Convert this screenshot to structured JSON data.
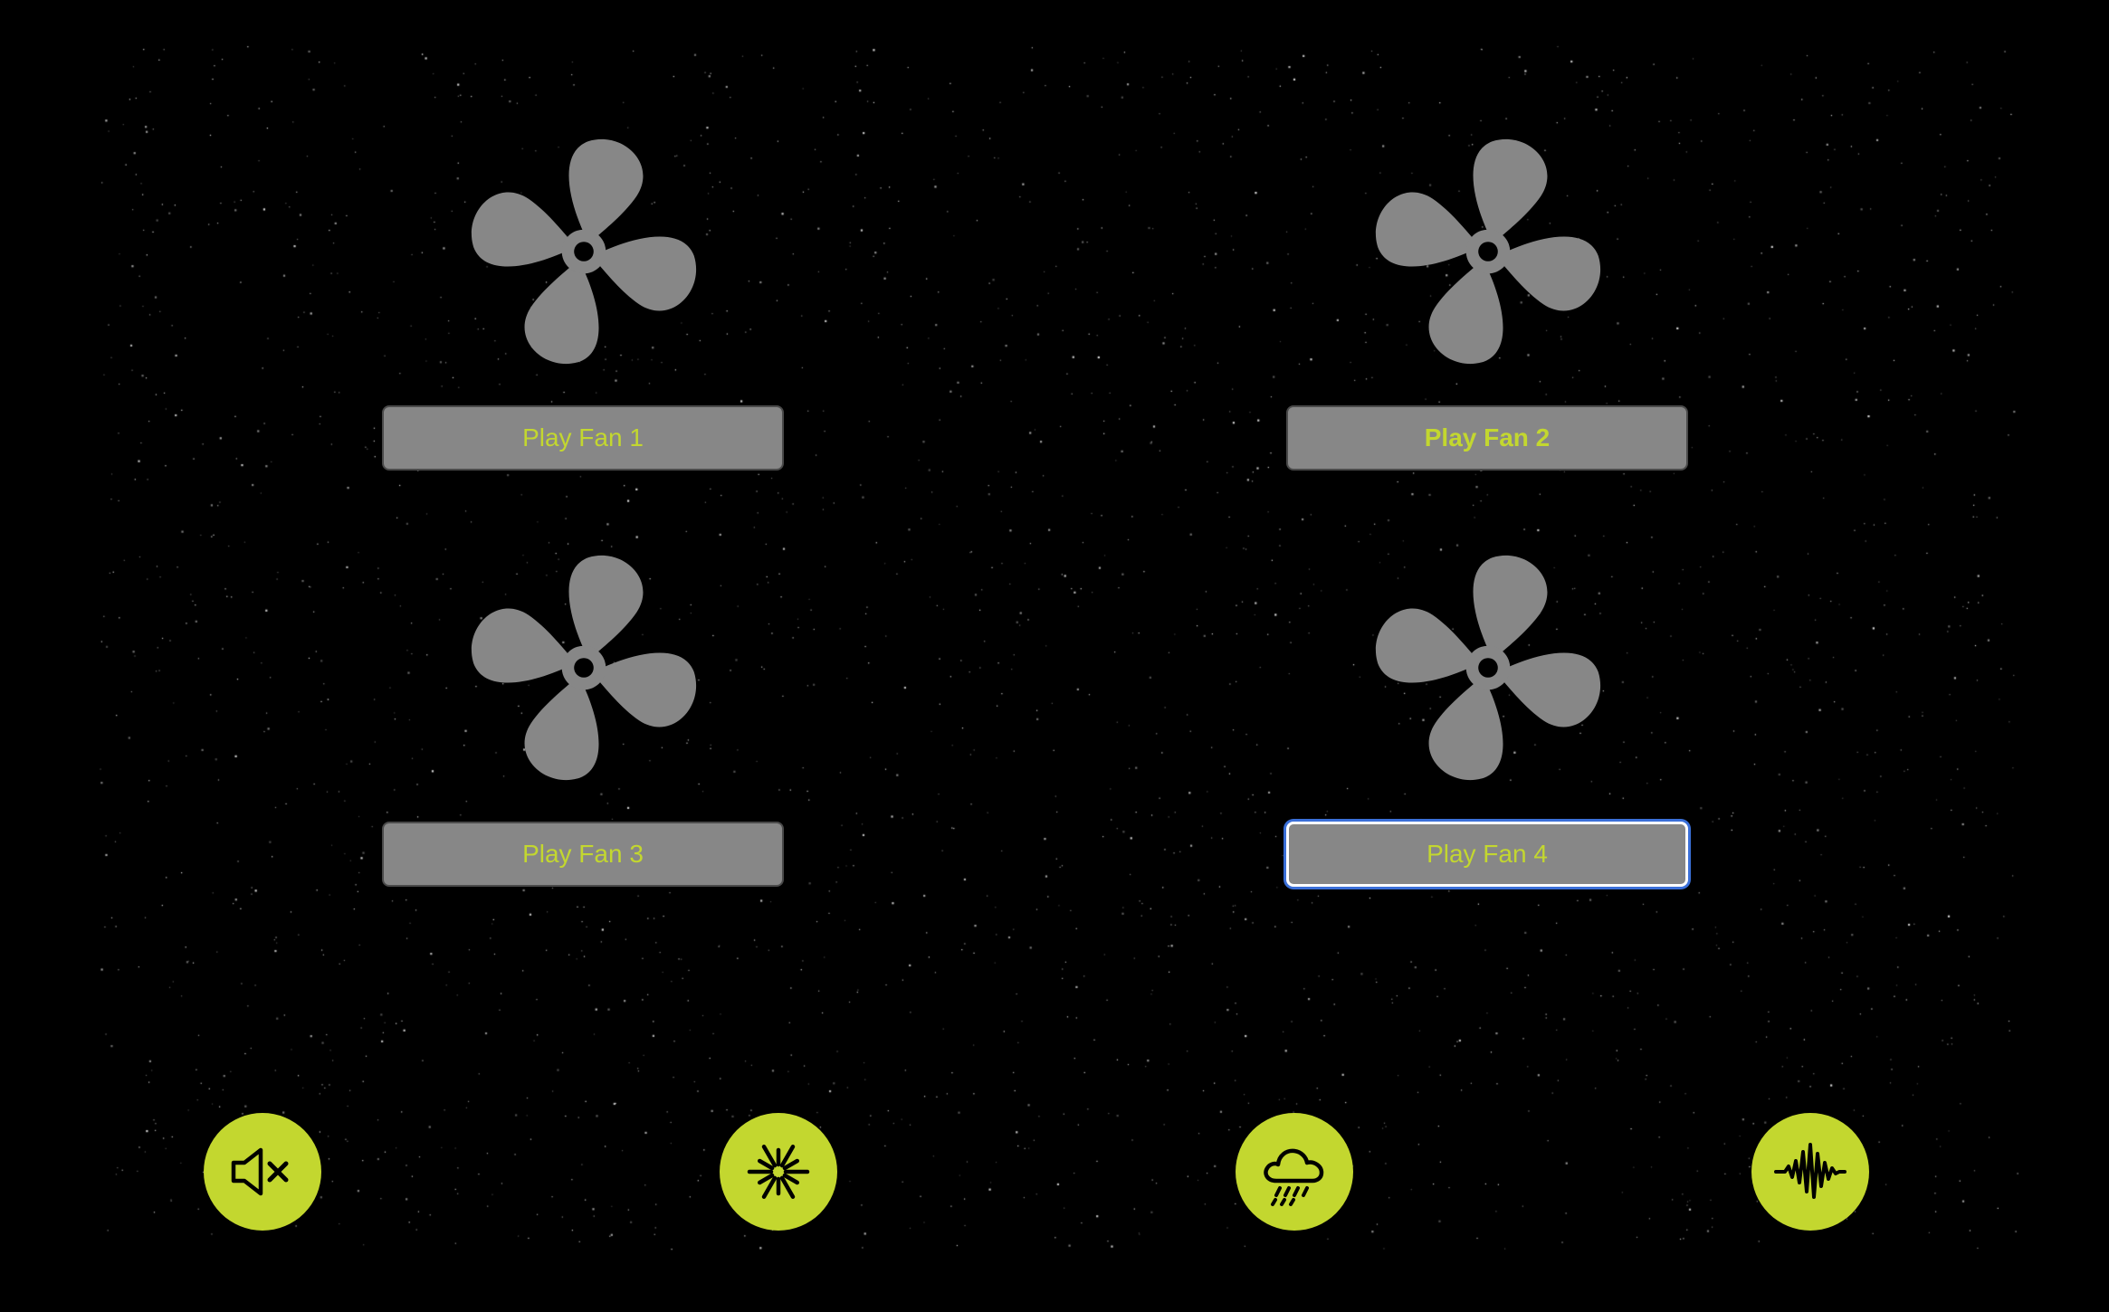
{
  "colors": {
    "background": "#000000",
    "fan_gray": "#878787",
    "accent": "#c3d72f",
    "focus_ring": "#3a6fd8"
  },
  "fans": [
    {
      "button_label": "Play Fan 1",
      "icon": "fan-icon"
    },
    {
      "button_label": "Play Fan 2",
      "icon": "fan-icon"
    },
    {
      "button_label": "Play Fan 3",
      "icon": "fan-icon"
    },
    {
      "button_label": "Play Fan 4",
      "icon": "fan-icon"
    }
  ],
  "toolbar": {
    "buttons": [
      {
        "icon": "mute-icon"
      },
      {
        "icon": "sparkle-icon"
      },
      {
        "icon": "rain-cloud-icon"
      },
      {
        "icon": "waveform-icon"
      }
    ]
  }
}
